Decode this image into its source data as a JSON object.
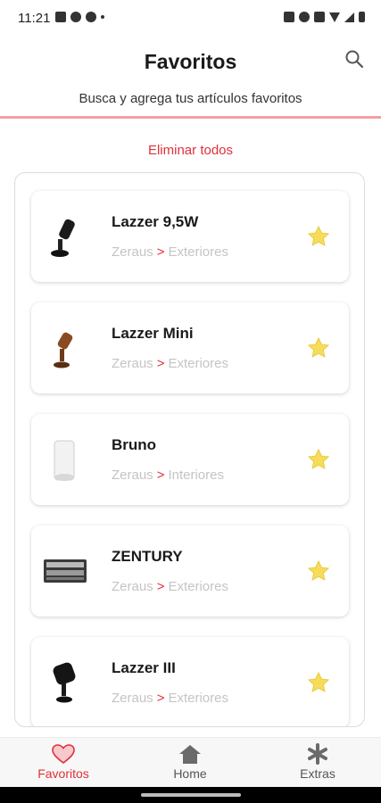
{
  "status_bar": {
    "time": "11:21"
  },
  "header": {
    "title": "Favoritos",
    "subtitle": "Busca y agrega tus artículos favoritos",
    "delete_all": "Eliminar todos"
  },
  "items": [
    {
      "name": "Lazzer 9,5W",
      "brand": "Zeraus",
      "separator": ">",
      "category": "Exteriores",
      "image": "spotlight-black"
    },
    {
      "name": "Lazzer Mini",
      "brand": "Zeraus",
      "separator": ">",
      "category": "Exteriores",
      "image": "spotlight-bronze"
    },
    {
      "name": "Bruno",
      "brand": "Zeraus",
      "separator": ">",
      "category": "Interiores",
      "image": "cylinder-white"
    },
    {
      "name": "ZENTURY",
      "brand": "Zeraus",
      "separator": ">",
      "category": "Exteriores",
      "image": "panel-light"
    },
    {
      "name": "Lazzer III",
      "brand": "Zeraus",
      "separator": ">",
      "category": "Exteriores",
      "image": "spotlight-large-black"
    }
  ],
  "nav": {
    "favorites": "Favoritos",
    "home": "Home",
    "extras": "Extras"
  },
  "colors": {
    "accent": "#e0303a",
    "star": "#f7dc5a",
    "divider": "#f2a0a4"
  }
}
